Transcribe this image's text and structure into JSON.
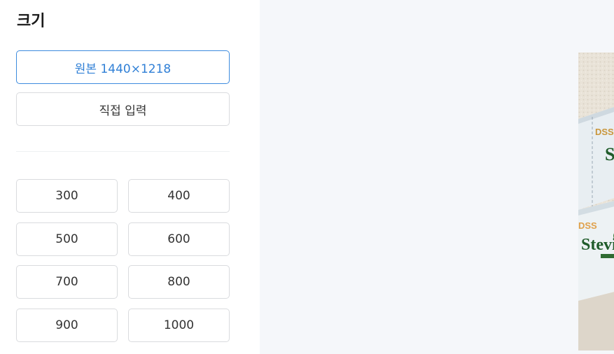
{
  "panel": {
    "title": "크기",
    "original_label": "원본 1440×1218",
    "custom_label": "직접 입력",
    "sizes": [
      "300",
      "400",
      "500",
      "600",
      "700",
      "800",
      "900",
      "1000"
    ]
  },
  "preview": {
    "image_text": [
      "DSS",
      "St",
      "DSS",
      "Stevi"
    ]
  },
  "colors": {
    "accent": "#2f7fd6",
    "preview_bg": "#f5f7fa",
    "border": "#d9dbde"
  }
}
